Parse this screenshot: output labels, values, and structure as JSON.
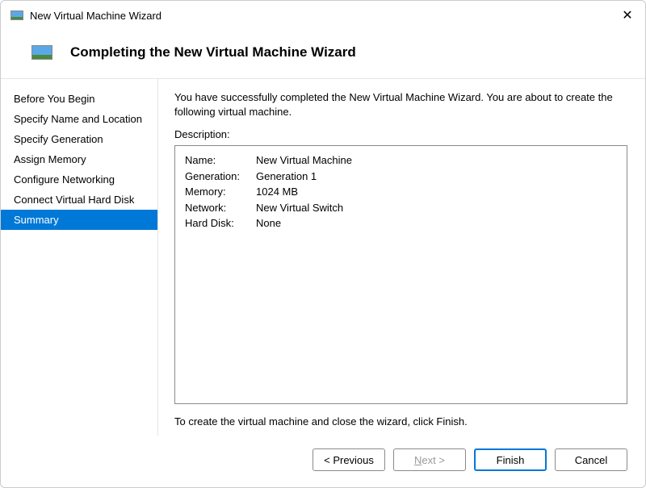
{
  "window": {
    "title": "New Virtual Machine Wizard"
  },
  "header": {
    "title": "Completing the New Virtual Machine Wizard"
  },
  "sidebar": {
    "items": [
      {
        "label": "Before You Begin"
      },
      {
        "label": "Specify Name and Location"
      },
      {
        "label": "Specify Generation"
      },
      {
        "label": "Assign Memory"
      },
      {
        "label": "Configure Networking"
      },
      {
        "label": "Connect Virtual Hard Disk"
      },
      {
        "label": "Summary"
      }
    ],
    "active_index": 6
  },
  "main": {
    "intro": "You have successfully completed the New Virtual Machine Wizard. You are about to create the following virtual machine.",
    "description_label": "Description:",
    "summary": [
      {
        "key": "Name:",
        "value": "New Virtual Machine"
      },
      {
        "key": "Generation:",
        "value": "Generation 1"
      },
      {
        "key": "Memory:",
        "value": "1024 MB"
      },
      {
        "key": "Network:",
        "value": "New Virtual Switch"
      },
      {
        "key": "Hard Disk:",
        "value": "None"
      }
    ],
    "finish_text": "To create the virtual machine and close the wizard, click Finish."
  },
  "buttons": {
    "previous_prefix": "< ",
    "previous": "Previous",
    "next": "Next",
    "next_suffix": " >",
    "finish": "Finish",
    "cancel": "Cancel"
  }
}
